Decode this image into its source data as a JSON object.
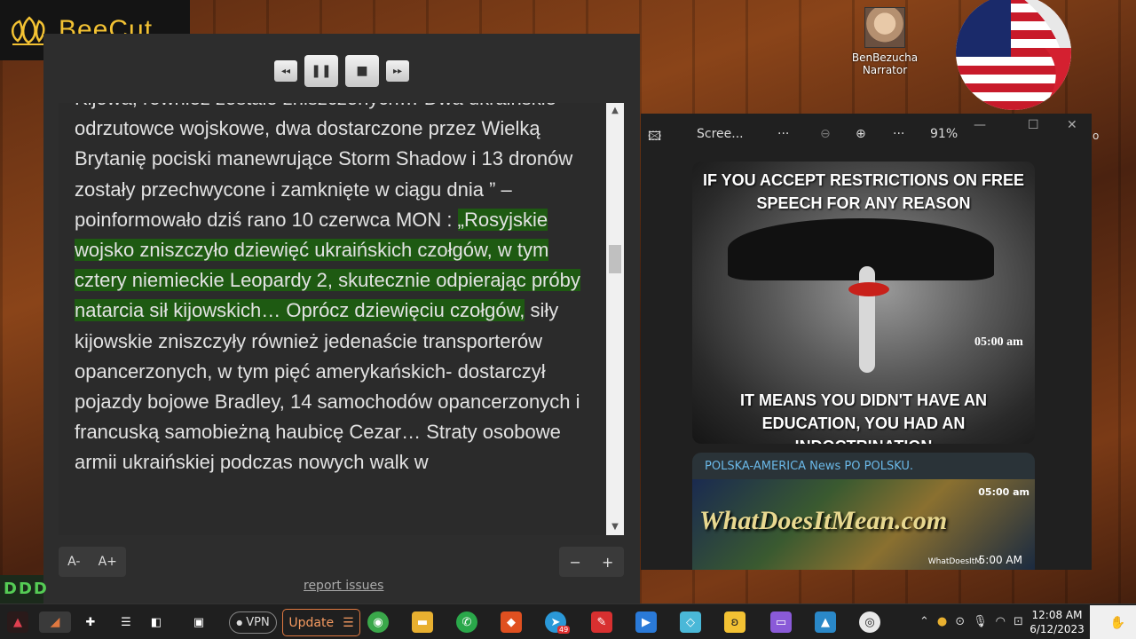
{
  "brand": {
    "name": "BeeCut"
  },
  "reader": {
    "text_before": "Kijowa, również zostało zniszczonych… Dwa ukraińskie odrzutowce wojskowe, dwa dostarczone przez Wielką Brytanię pociski manewrujące Storm Shadow i 13 dronów zostały przechwycone i zamknięte w ciągu dnia ” – poinformowało dziś rano 10 czerwca MON : ",
    "text_highlight": "„Rosyjskie wojsko zniszczyło dziewięć ukraińskich czołgów, w tym cztery niemieckie Leopardy 2, skutecznie odpierając próby natarcia sił kijowskich… Oprócz dziewięciu czołgów,",
    "text_after": " siły kijowskie zniszczyły również jedenaście transporterów opancerzonych, w tym pięć amerykańskich- dostarczył pojazdy bojowe Bradley, 14 samochodów opancerzonych i francuską samobieżną haubicę Cezar… Straty osobowe armii ukraińskiej podczas nowych walk w",
    "font_smaller": "A-",
    "font_larger": "A+",
    "zoom_minus": "−",
    "zoom_plus": "+",
    "report_link": "report issues",
    "controls": {
      "rewind": "◂◂",
      "pause": "❚❚",
      "stop": "■",
      "forward": "▸▸"
    }
  },
  "narrator": {
    "name": "BenBezucha",
    "role": "Narrator"
  },
  "viewer": {
    "title": "Scree...",
    "more1": "···",
    "more2": "···",
    "zoom": "91%",
    "min": "—",
    "max": "☐",
    "close": "✕",
    "edge_char": "o",
    "card1": {
      "top_text": "IF YOU ACCEPT RESTRICTIONS ON FREE SPEECH FOR ANY REASON",
      "bottom_text": "IT MEANS YOU DIDN'T HAVE AN EDUCATION, YOU HAD AN INDOCTRINATION",
      "time": "05:00 am"
    },
    "card2": {
      "title": "POLSKA-AMERICA News PO POLSKU.",
      "image_text": "WhatDoesItMean.com",
      "time_top": "05:00 am",
      "source": "WhatDoesItM",
      "time": "5:00 AM"
    }
  },
  "taskbar": {
    "vpn": "VPN",
    "update": "Update",
    "update_menu": "☰",
    "badge": "49",
    "time": "12:08 AM",
    "date": "6/12/2023"
  },
  "left_strip": "DDD"
}
